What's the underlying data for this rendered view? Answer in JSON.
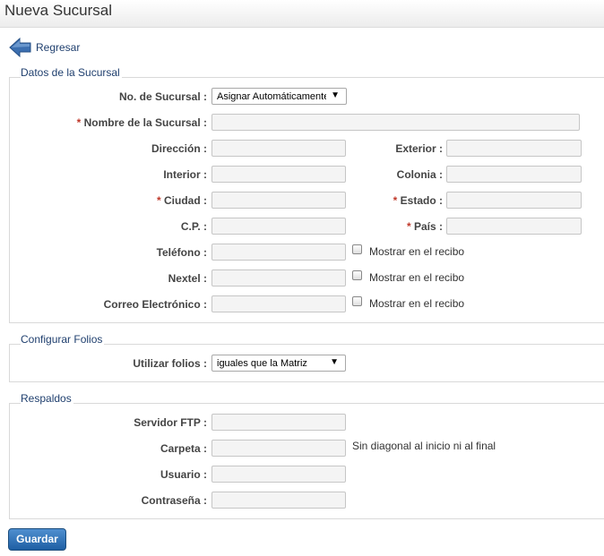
{
  "page": {
    "title": "Nueva Sucursal"
  },
  "nav": {
    "back_label": "Regresar"
  },
  "sections": {
    "datos": {
      "legend": "Datos de la Sucursal"
    },
    "folios": {
      "legend": "Configurar Folios"
    },
    "respaldos": {
      "legend": "Respaldos"
    }
  },
  "form": {
    "no_sucursal": {
      "label": "No. de Sucursal :",
      "value": "Asignar Automáticamente"
    },
    "nombre": {
      "label": "Nombre de la Sucursal :",
      "required": "*",
      "value": ""
    },
    "direccion": {
      "label": "Dirección :",
      "value": ""
    },
    "exterior": {
      "label": "Exterior :",
      "value": ""
    },
    "interior": {
      "label": "Interior :",
      "value": ""
    },
    "colonia": {
      "label": "Colonia :",
      "value": ""
    },
    "ciudad": {
      "label": "Ciudad :",
      "required": "*",
      "value": ""
    },
    "estado": {
      "label": "Estado :",
      "required": "*",
      "value": ""
    },
    "cp": {
      "label": "C.P. :",
      "value": ""
    },
    "pais": {
      "label": "País :",
      "required": "*",
      "value": ""
    },
    "telefono": {
      "label": "Teléfono :",
      "value": "",
      "checkbox_label": "Mostrar en el recibo",
      "checked": false
    },
    "nextel": {
      "label": "Nextel :",
      "value": "",
      "checkbox_label": "Mostrar en el recibo",
      "checked": false
    },
    "correo": {
      "label": "Correo Electrónico :",
      "value": "",
      "checkbox_label": "Mostrar en el recibo",
      "checked": false
    },
    "utilizar_folios": {
      "label": "Utilizar folios :",
      "value": "iguales que la Matriz"
    },
    "servidor_ftp": {
      "label": "Servidor FTP :",
      "value": ""
    },
    "carpeta": {
      "label": "Carpeta :",
      "value": "",
      "hint": "Sin diagonal al inicio ni al final"
    },
    "usuario": {
      "label": "Usuario :",
      "value": ""
    },
    "contrasena": {
      "label": "Contraseña :",
      "value": ""
    }
  },
  "actions": {
    "save_label": "Guardar"
  },
  "icons": {
    "back": "back-arrow-icon",
    "dropdown": "chevron-down-icon"
  },
  "colors": {
    "accent": "#1e5fa3",
    "required": "#c0392b",
    "link": "#1f3f6e"
  }
}
